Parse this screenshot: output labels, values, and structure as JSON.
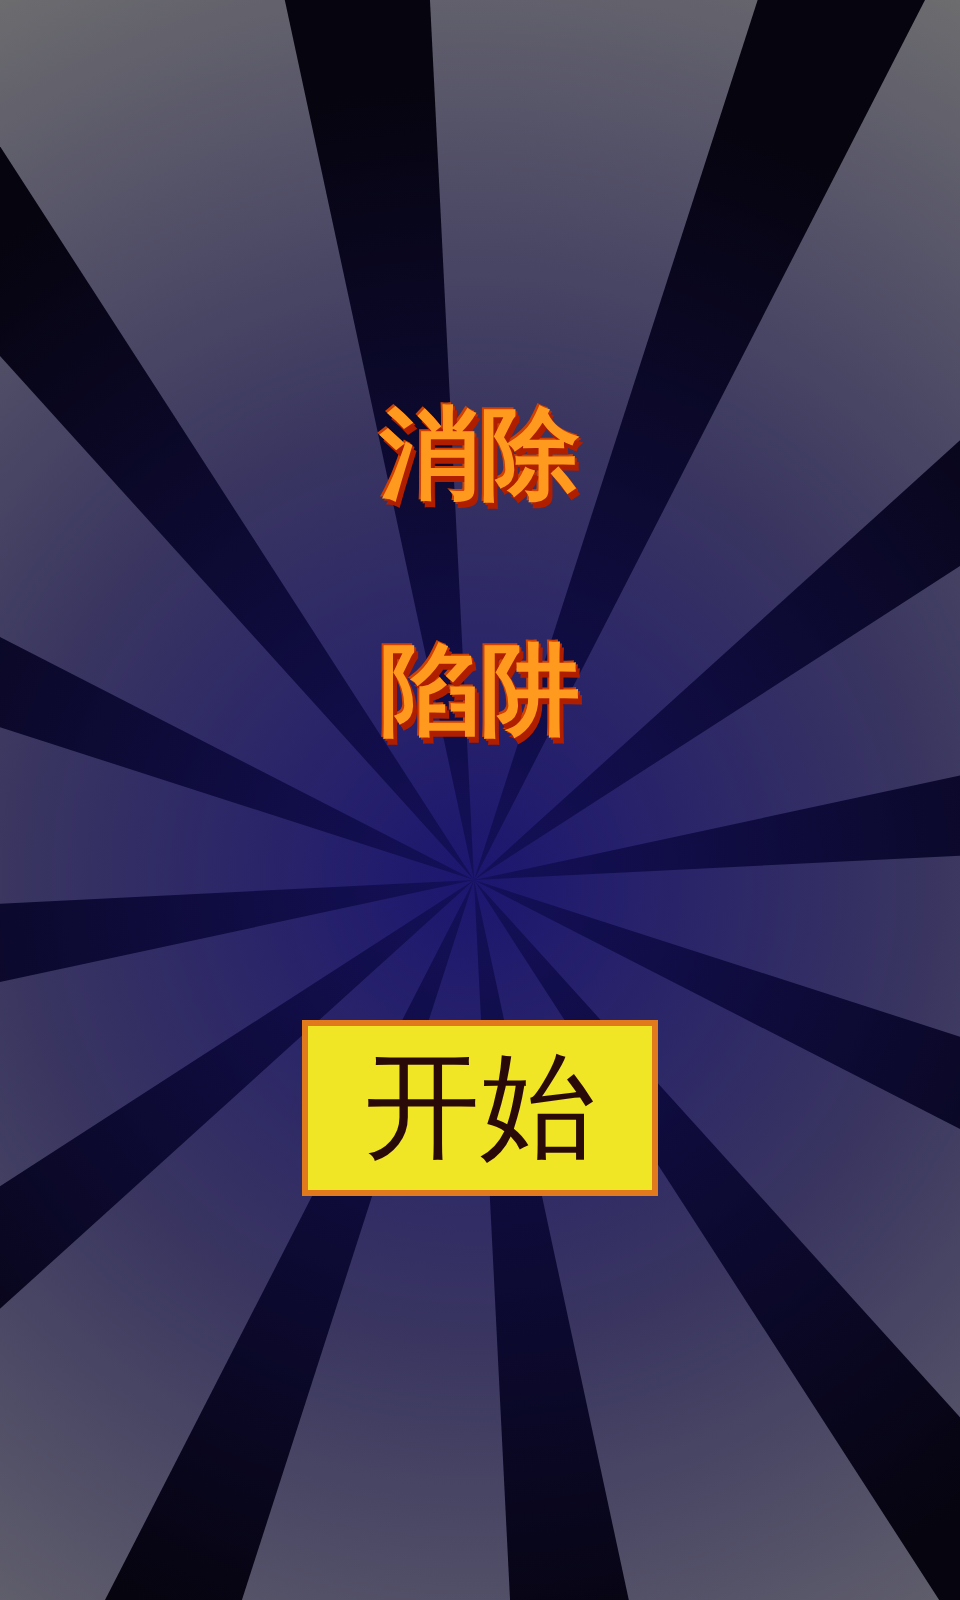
{
  "title_lines": [
    "消除",
    "陷阱"
  ],
  "start_button": {
    "label": "开始"
  }
}
